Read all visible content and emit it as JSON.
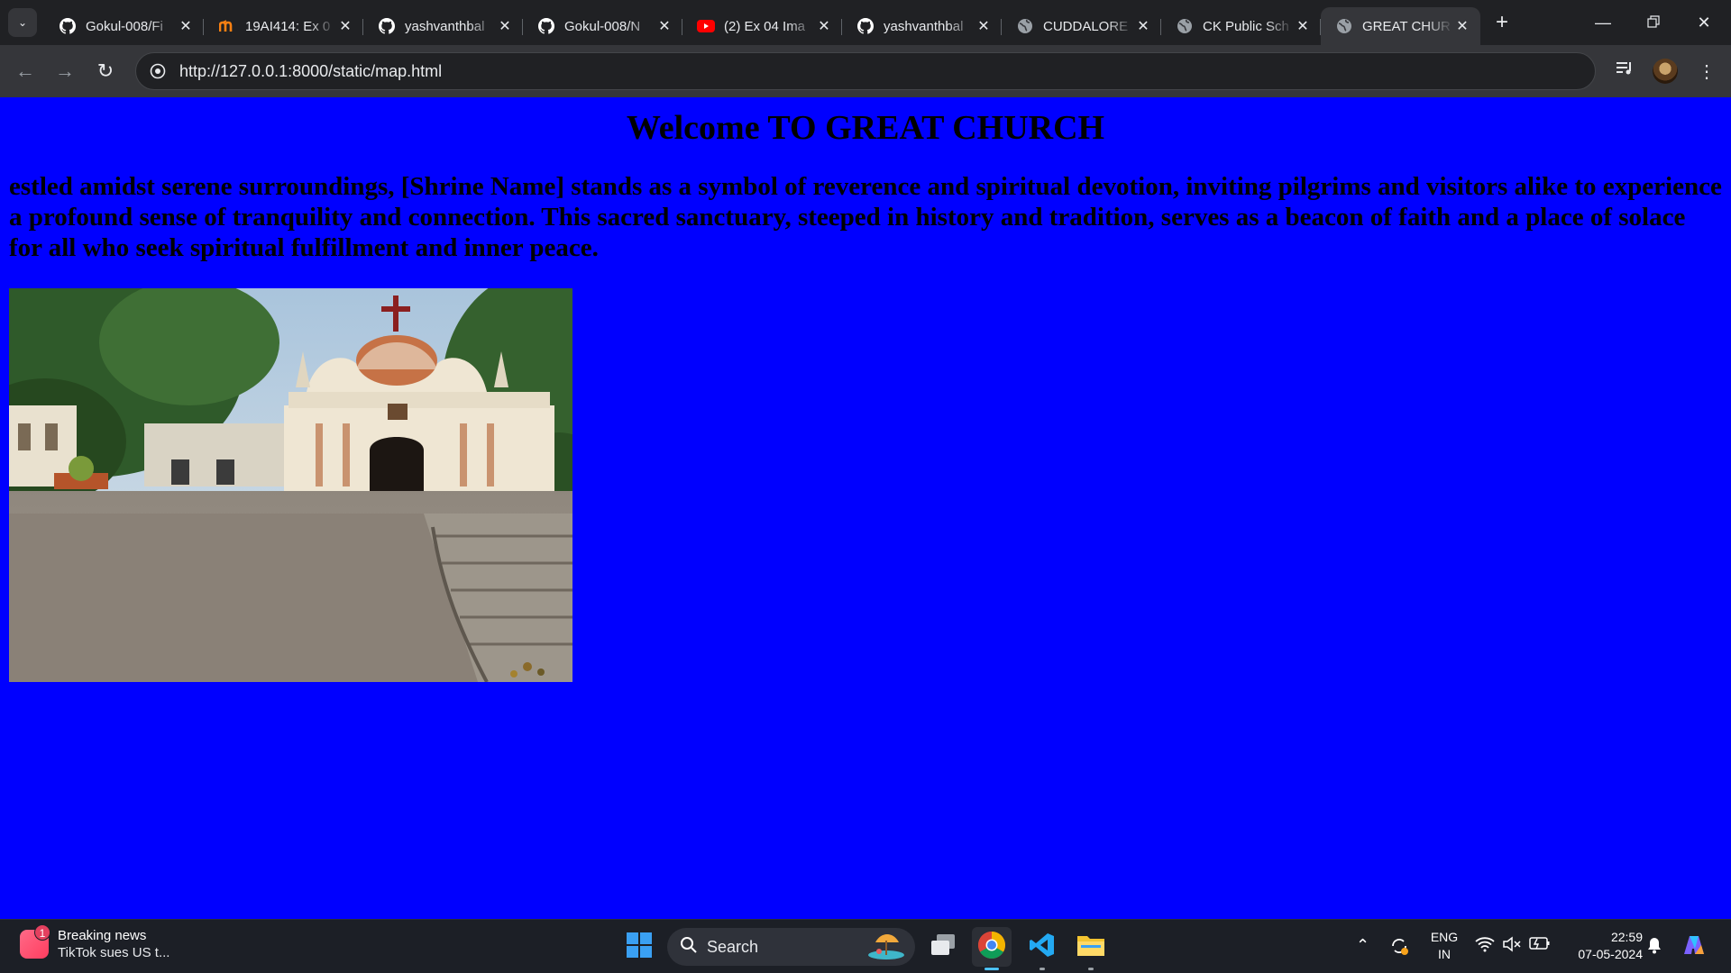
{
  "browser": {
    "tabs": [
      {
        "title": "Gokul-008/Fi",
        "icon": "github-icon"
      },
      {
        "title": "19AI414: Ex 0",
        "icon": "moodle-icon"
      },
      {
        "title": "yashvanthbal",
        "icon": "github-icon"
      },
      {
        "title": "Gokul-008/N",
        "icon": "github-icon"
      },
      {
        "title": "(2) Ex 04 Ima",
        "icon": "youtube-icon"
      },
      {
        "title": "yashvanthbal",
        "icon": "github-icon"
      },
      {
        "title": "CUDDALORE",
        "icon": "globe-icon"
      },
      {
        "title": "CK Public Sch",
        "icon": "globe-icon"
      },
      {
        "title": "GREAT CHUR",
        "icon": "globe-icon",
        "active": true
      }
    ],
    "url": "http://127.0.0.1:8000/static/map.html"
  },
  "page": {
    "heading": "Welcome TO GREAT CHURCH",
    "paragraph": "estled amidst serene surroundings, [Shrine Name] stands as a symbol of reverence and spiritual devotion, inviting pilgrims and visitors alike to experience a profound sense of tranquility and connection. This sacred sanctuary, steeped in history and tradition, serves as a beacon of faith and a place of solace for all who seek spiritual fulfillment and inner peace.",
    "background_color": "#0000ff"
  },
  "taskbar": {
    "news_badge": "1",
    "news_title": "Breaking news",
    "news_subtitle": "TikTok sues US t...",
    "search_label": "Search",
    "language_top": "ENG",
    "language_bottom": "IN",
    "time": "22:59",
    "date": "07-05-2024"
  }
}
